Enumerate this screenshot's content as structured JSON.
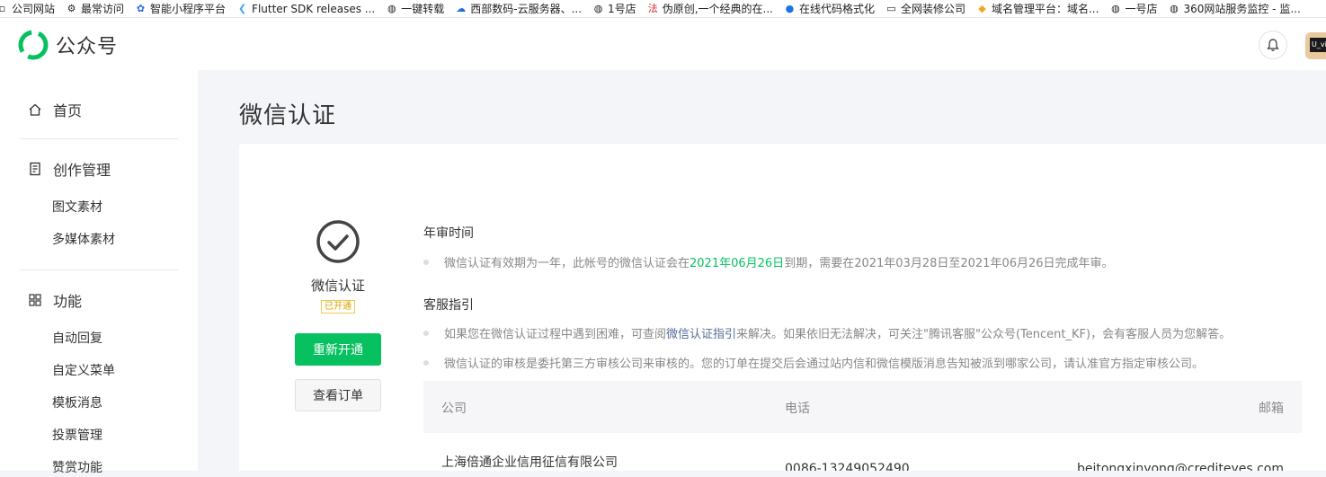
{
  "bookmarks": [
    {
      "icon": "page-icon",
      "label": "公司网站"
    },
    {
      "icon": "gear-icon",
      "label": "最常访问"
    },
    {
      "icon": "paw-icon",
      "label": "智能小程序平台"
    },
    {
      "icon": "flutter-icon",
      "label": "Flutter SDK releases ..."
    },
    {
      "icon": "globe-icon",
      "label": "一键转载"
    },
    {
      "icon": "cloud-icon",
      "label": "西部数码-云服务器、..."
    },
    {
      "icon": "globe-icon",
      "label": "1号店"
    },
    {
      "icon": "fa-icon",
      "label": "伪原创,一个经典的在..."
    },
    {
      "icon": "c-icon",
      "label": "在线代码格式化"
    },
    {
      "icon": "folder-icon",
      "label": "全网装修公司"
    },
    {
      "icon": "domain-icon",
      "label": "域名管理平台：域名..."
    },
    {
      "icon": "globe-icon",
      "label": "一号店"
    },
    {
      "icon": "globe-icon",
      "label": "360网站服务监控 - 监..."
    }
  ],
  "header": {
    "logo_text": "公众号",
    "avatar_text": "U_vi"
  },
  "sidebar": {
    "home": "首页",
    "creation": "创作管理",
    "creation_items": [
      "图文素材",
      "多媒体素材"
    ],
    "features": "功能",
    "feature_items": [
      "自动回复",
      "自定义菜单",
      "模板消息",
      "投票管理",
      "赞赏功能"
    ]
  },
  "main": {
    "title": "微信认证",
    "status_name": "微信认证",
    "status_badge": "已开通",
    "reopen_button": "重新开通",
    "orders_button": "查看订单",
    "annual_title": "年审时间",
    "annual_text_1": "微信认证有效期为一年，此帐号的微信认证会在",
    "annual_date": "2021年06月26日",
    "annual_text_2": "到期，需要在2021年03月28日至2021年06月26日完成年审。",
    "support_title": "客服指引",
    "support_text_1": "如果您在微信认证过程中遇到困难，可查阅",
    "support_link": "微信认证指引",
    "support_text_2": "来解决。如果依旧无法解决，可关注\"腾讯客服\"公众号(Tencent_KF)，会有客服人员为您解答。",
    "support_text_3": "微信认证的审核是委托第三方审核公司来审核的。您的订单在提交后会通过站内信和微信模版消息告知被派到哪家公司，请认准官方指定审核公司。",
    "table": {
      "col_company": "公司",
      "col_phone": "电话",
      "col_email": "邮箱",
      "rows": [
        {
          "company": "上海倍通企业信用征信有限公司",
          "phone": "0086-13249052490",
          "email": "beitongxinyong@crediteyes.com"
        }
      ]
    }
  },
  "colors": {
    "brand_green": "#07c160",
    "link_blue": "#576b95",
    "badge_yellow": "#d6a400"
  }
}
